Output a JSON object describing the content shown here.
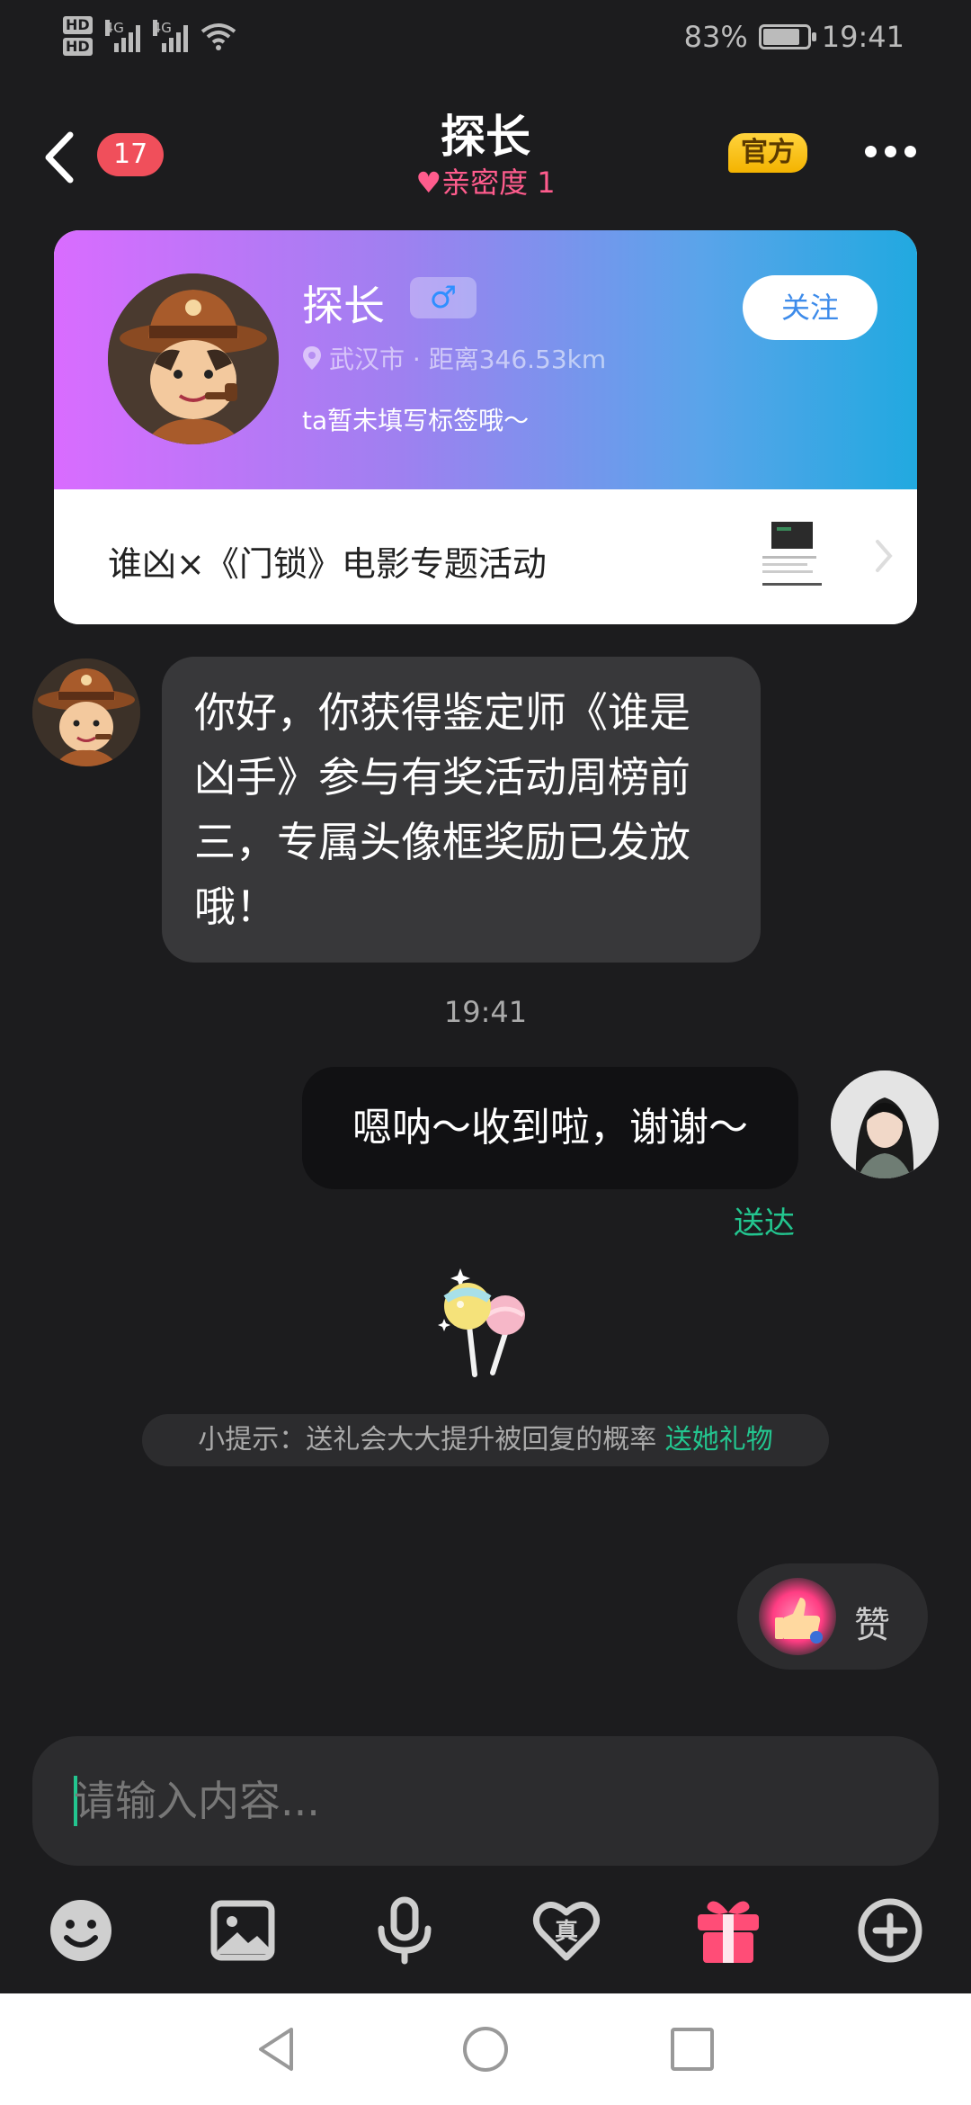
{
  "status_bar": {
    "hd1": "HD",
    "hd2": "HD",
    "sim1_label": "4G",
    "sim2_label": "4G",
    "battery_percent": "83%",
    "battery_level": 0.83,
    "time": "19:41"
  },
  "header": {
    "unread_count": "17",
    "title": "探长",
    "intimacy": "亲密度 1",
    "official_tag": "官方"
  },
  "profile": {
    "name": "探长",
    "gender_symbol": "♂",
    "location": "武汉市 · 距离346.53km",
    "signature": "ta暂未填写标签哦～",
    "follow_label": "关注",
    "promo_text": "谁凶×《门锁》电影专题活动"
  },
  "messages": {
    "incoming_text": "你好，你获得鉴定师《谁是凶手》参与有奖活动周榜前三，专属头像框奖励已发放哦！",
    "timestamp": "19:41",
    "outgoing_text": "嗯呐～收到啦，谢谢～",
    "delivered": "送达"
  },
  "tip": {
    "text": "小提示：送礼会大大提升被回复的概率 ",
    "link": "送她礼物"
  },
  "like": {
    "label": "赞"
  },
  "input": {
    "placeholder": "请输入内容..."
  },
  "toolbar": {
    "items": [
      "emoji-icon",
      "image-icon",
      "microphone-icon",
      "heart-real-icon",
      "gift-icon",
      "plus-icon"
    ],
    "heart_label": "真",
    "gift_color": "#ff4d77"
  },
  "colors": {
    "accent_green": "#23c58f",
    "badge_red": "#f04f5b",
    "intimacy_pink": "#ff5c8d"
  }
}
